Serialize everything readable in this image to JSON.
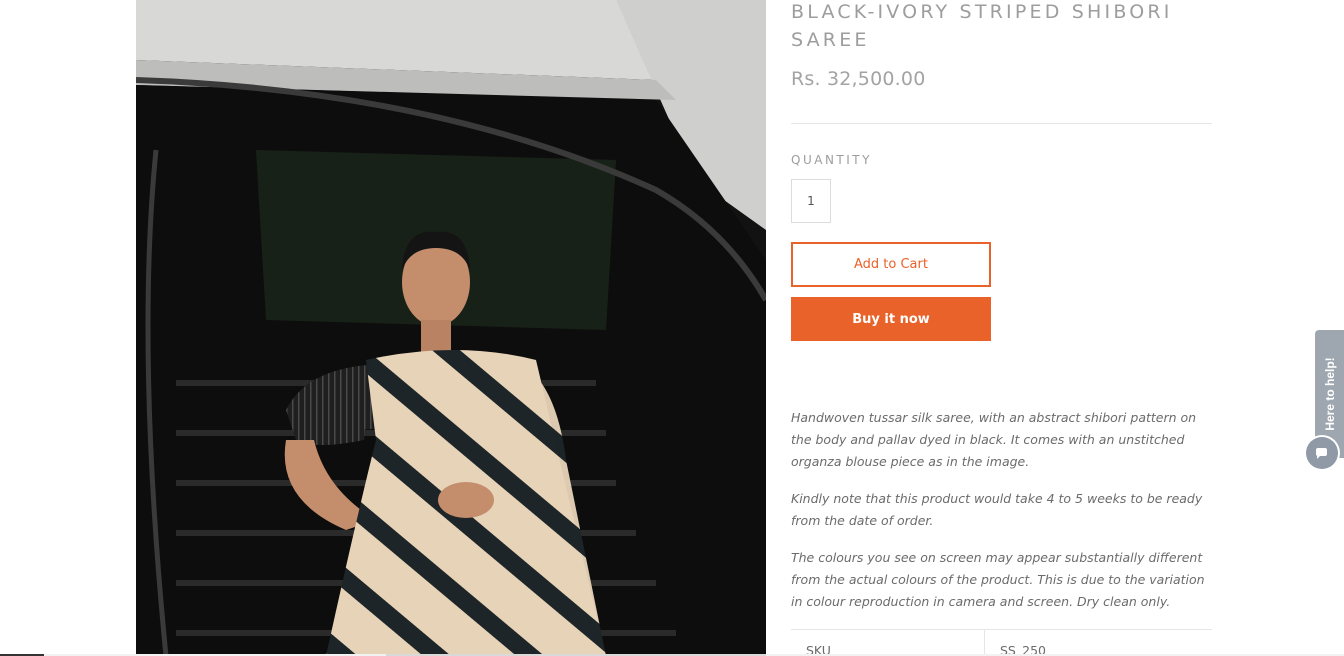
{
  "product": {
    "title": "BLACK-IVORY STRIPED SHIBORI SAREE",
    "price": "Rs. 32,500.00",
    "quantity_label": "QUANTITY",
    "quantity_value": "1",
    "add_to_cart_label": "Add to Cart",
    "buy_now_label": "Buy it now",
    "description": [
      "Handwoven tussar silk saree, with an abstract shibori pattern on the body and pallav dyed in black. It comes with an unstitched organza blouse piece as in the image.",
      "Kindly note that this product would take 4 to 5 weeks to be ready from the date of order.",
      "The colours you see on screen may appear substantially different from the actual colours of the product. This is due to the variation in colour reproduction in camera and screen. Dry clean only."
    ],
    "specs": [
      {
        "key": "SKU",
        "value": "SS_250"
      }
    ]
  },
  "help_widget": {
    "label": "Here to help!",
    "icon": "chat-icon"
  },
  "colors": {
    "accent": "#e9622a",
    "muted_text": "#9d9d9d",
    "body_text": "#6b6b6b",
    "help_tab": "#9ea7b0"
  }
}
